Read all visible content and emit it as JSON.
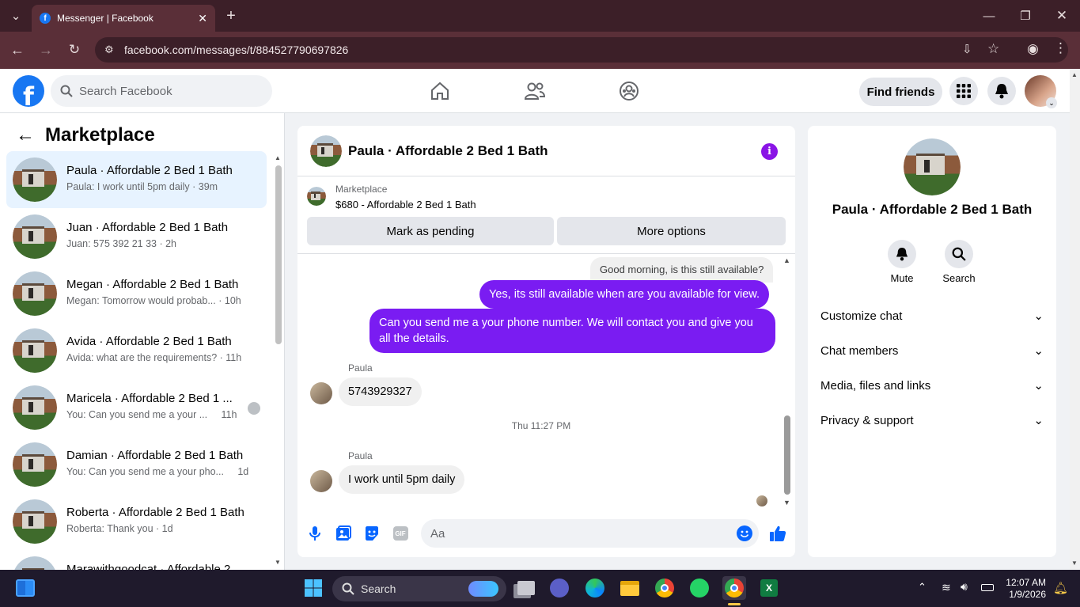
{
  "browser": {
    "tab_title": "Messenger | Facebook",
    "url": "facebook.com/messages/t/884527790697826"
  },
  "fb_header": {
    "search_placeholder": "Search Facebook",
    "find_friends": "Find friends"
  },
  "sidebar": {
    "title": "Marketplace",
    "conversations": [
      {
        "name": "Paula · Affordable 2 Bed 1 Bath",
        "preview": "Paula: I work until 5pm daily · 39m"
      },
      {
        "name": "Juan · Affordable 2 Bed 1 Bath",
        "preview": "Juan: 575 392 21 33 · 2h"
      },
      {
        "name": "Megan · Affordable 2 Bed 1 Bath",
        "preview": "Megan: Tomorrow would probab... · 10h"
      },
      {
        "name": "Avida · Affordable 2 Bed 1 Bath",
        "preview": "Avida: what are the requirements? · 11h"
      },
      {
        "name": "Maricela · Affordable 2 Bed 1 ...",
        "preview": "You: Can you send me a your ...     11h"
      },
      {
        "name": "Damian · Affordable 2 Bed 1 Bath",
        "preview": "You: Can you send me a your pho...     1d"
      },
      {
        "name": "Roberta · Affordable 2 Bed 1 Bath",
        "preview": "Roberta: Thank you · 1d"
      },
      {
        "name": "Marawithgoodcat · Affordable 2 ...",
        "preview": ""
      }
    ]
  },
  "chat": {
    "title": "Paula · Affordable 2 Bed 1 Bath",
    "marketplace_label": "Marketplace",
    "listing": "$680 - Affordable 2 Bed 1 Bath",
    "mark_pending": "Mark as pending",
    "more_options": "More options",
    "messages": {
      "m1": "Good morning, is this still available?",
      "m2": "Yes, its still available when are you available for view.",
      "m3": "Can you send me a your phone number. We will contact you and give you all the details.",
      "sender1": "Paula",
      "m4": "5743929327",
      "timestamp": "Thu 11:27 PM",
      "sender2": "Paula",
      "m5": "I work until 5pm daily"
    },
    "composer_placeholder": "Aa",
    "gif_label": "GIF"
  },
  "info_panel": {
    "name": "Paula · Affordable 2 Bed 1 Bath",
    "mute": "Mute",
    "search": "Search",
    "sections": [
      "Customize chat",
      "Chat members",
      "Media, files and links",
      "Privacy & support"
    ]
  },
  "taskbar": {
    "search": "Search",
    "time": "12:07 AM",
    "date": "1/9/2026"
  },
  "colors": {
    "fb_blue": "#1877f2",
    "outgoing_bubble": "#7a1cf2",
    "chrome_bg": "#5a2f38"
  }
}
